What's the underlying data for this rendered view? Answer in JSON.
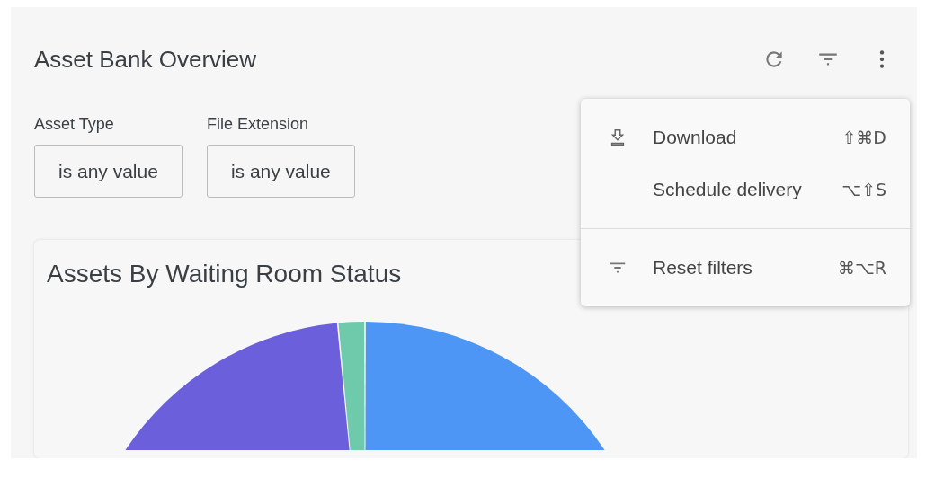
{
  "dashboard": {
    "title": "Asset Bank Overview"
  },
  "filters": [
    {
      "label": "Asset Type",
      "value": "is any value"
    },
    {
      "label": "File Extension",
      "value": "is any value"
    }
  ],
  "menu": {
    "groups": [
      [
        {
          "kind": "download",
          "label": "Download",
          "shortcut": "⇧⌘D"
        },
        {
          "kind": "plain",
          "label": "Schedule delivery",
          "shortcut": "⌥⇧S"
        }
      ],
      [
        {
          "kind": "filter",
          "label": "Reset filters",
          "shortcut": "⌘⌥R"
        }
      ]
    ]
  },
  "tile": {
    "title": "Assets By Waiting Room Status"
  }
}
